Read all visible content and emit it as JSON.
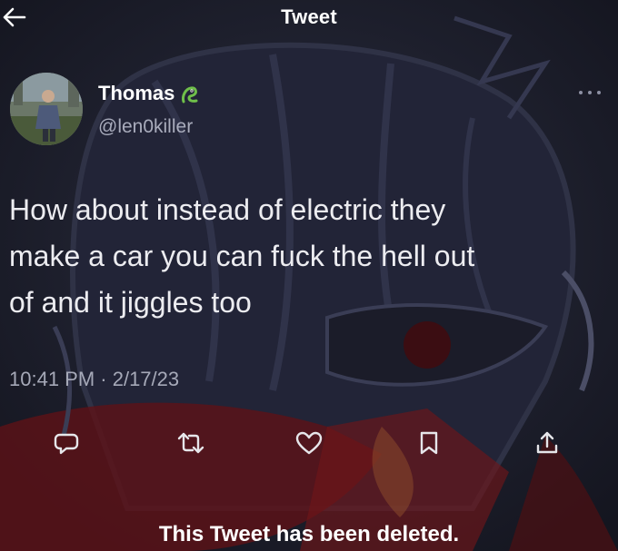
{
  "header": {
    "title": "Tweet",
    "back_icon": "arrow-left-icon"
  },
  "author": {
    "display_name": "Thomas",
    "handle": "@len0killer",
    "badge_icon": "green-creature-emoji"
  },
  "tweet": {
    "text": "How about instead of electric they\nmake a car you can fuck the hell out\nof and it jiggles too",
    "timestamp": "10:41 PM · 2/17/23"
  },
  "actions": [
    {
      "icon": "reply-icon"
    },
    {
      "icon": "retweet-icon"
    },
    {
      "icon": "like-icon"
    },
    {
      "icon": "bookmark-icon"
    },
    {
      "icon": "share-icon"
    }
  ],
  "overlay_caption": "This Tweet has been deleted.",
  "colors": {
    "background": "#1a1c2a",
    "text": "#ececf0",
    "muted": "#a6a9b8",
    "accent_red": "#7a1418"
  }
}
